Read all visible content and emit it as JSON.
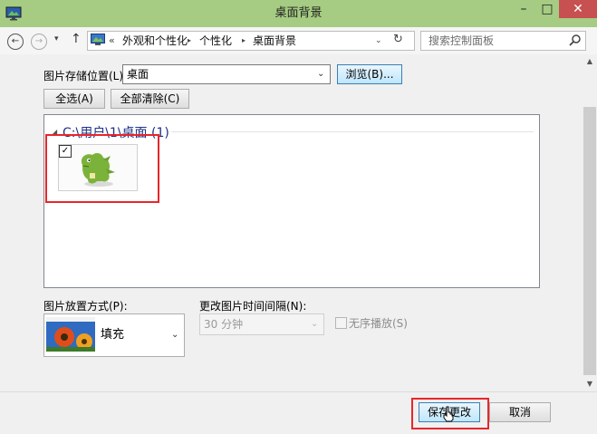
{
  "window": {
    "title": "桌面背景",
    "min_glyph": "–",
    "max_glyph": "□",
    "close_glyph": "✕"
  },
  "nav": {
    "back_glyph": "←",
    "forward_glyph": "→",
    "dropdown_glyph": "▾",
    "up_glyph": "↑"
  },
  "breadcrumb": {
    "overflow": "«",
    "items": [
      "外观和个性化",
      "个性化",
      "桌面背景"
    ],
    "sep": "▸",
    "dropdown_glyph": "⌄",
    "refresh_glyph": "↻"
  },
  "search": {
    "placeholder": "搜索控制面板"
  },
  "location": {
    "label": "图片存储位置(L):",
    "value": "桌面",
    "dropdown_glyph": "⌄",
    "browse_label": "浏览(B)..."
  },
  "selection": {
    "select_all": "全选(A)",
    "clear_all": "全部清除(C)"
  },
  "gallery": {
    "group_arrow": "◢",
    "group_title": "C:\\用户\\1\\桌面 (1)",
    "items": [
      {
        "checked": true,
        "check_glyph": "✓"
      }
    ]
  },
  "position": {
    "label": "图片放置方式(P):",
    "value": "填充",
    "dropdown_glyph": "⌄"
  },
  "interval": {
    "label": "更改图片时间间隔(N):",
    "value": "30 分钟",
    "dropdown_glyph": "⌄"
  },
  "shuffle": {
    "label": "无序播放(S)",
    "checked": false
  },
  "scrollbar": {
    "up_glyph": "▲",
    "down_glyph": "▼"
  },
  "actions": {
    "save": "保存更改",
    "cancel": "取消"
  },
  "colors": {
    "titlebar": "#a5cc82",
    "close": "#c75050",
    "highlight": "#e8262b",
    "group_title": "#1e3287"
  }
}
